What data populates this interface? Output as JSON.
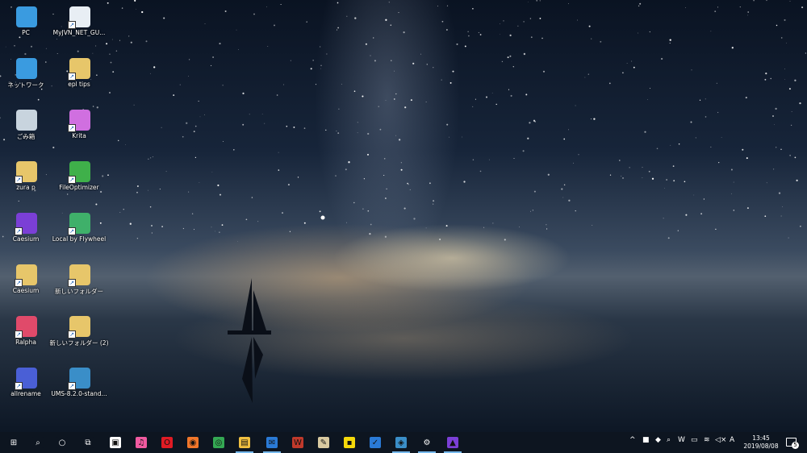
{
  "desktop": {
    "icons": [
      {
        "label": "PC",
        "icon": "this-pc-icon",
        "color": "#3a9be0"
      },
      {
        "label": "MyJVN_NET_GU...",
        "icon": "app-window-icon",
        "color": "#e8eef4"
      },
      {
        "label": "ネットワーク",
        "icon": "network-icon",
        "color": "#3a9be0"
      },
      {
        "label": "epl tips",
        "icon": "folder-icon",
        "color": "#e7c66a"
      },
      {
        "label": "ごみ箱",
        "icon": "recycle-bin-icon",
        "color": "#c8d4de"
      },
      {
        "label": "Krita",
        "icon": "krita-icon",
        "color": "#d06fe0"
      },
      {
        "label": "zura p",
        "icon": "user-folder-icon",
        "color": "#e7c66a"
      },
      {
        "label": "FileOptimizer",
        "icon": "fileoptimizer-icon",
        "color": "#3fb04a"
      },
      {
        "label": "Caesium",
        "icon": "caesium-icon",
        "color": "#7b3fd6"
      },
      {
        "label": "Local by Flywheel",
        "icon": "flywheel-icon",
        "color": "#3fb06a"
      },
      {
        "label": "Caesium",
        "icon": "folder-icon",
        "color": "#e7c66a"
      },
      {
        "label": "新しいフォルダー",
        "icon": "folder-icon",
        "color": "#e7c66a"
      },
      {
        "label": "Ralpha",
        "icon": "ralpha-icon",
        "color": "#e04a6a"
      },
      {
        "label": "新しいフォルダー (2)",
        "icon": "folder-icon",
        "color": "#e7c66a"
      },
      {
        "label": "allrename",
        "icon": "allrename-icon",
        "color": "#4a5fd6"
      },
      {
        "label": "UMS-8.2.0-stand...",
        "icon": "ums-icon",
        "color": "#3a8ec8"
      }
    ]
  },
  "taskbar": {
    "apps": [
      {
        "name": "start-button",
        "glyph": "⊞",
        "color": "#0d1520"
      },
      {
        "name": "search-icon",
        "glyph": "⌕",
        "color": "#0d1520"
      },
      {
        "name": "cortana-icon",
        "glyph": "○",
        "color": "#0d1520"
      },
      {
        "name": "task-view-icon",
        "glyph": "⧉",
        "color": "#0d1520"
      },
      {
        "name": "store-icon",
        "glyph": "▣",
        "color": "#ffffff"
      },
      {
        "name": "itunes-icon",
        "glyph": "♫",
        "color": "#f05aa0"
      },
      {
        "name": "opera-icon",
        "glyph": "O",
        "color": "#e01b24"
      },
      {
        "name": "firefox-icon",
        "glyph": "◉",
        "color": "#f0762a"
      },
      {
        "name": "chrome-icon",
        "glyph": "◎",
        "color": "#34a853"
      },
      {
        "name": "file-explorer-icon",
        "glyph": "▤",
        "color": "#f0c040"
      },
      {
        "name": "outlook-icon",
        "glyph": "✉",
        "color": "#2a7ad6"
      },
      {
        "name": "winamp-icon",
        "glyph": "W",
        "color": "#c0392b"
      },
      {
        "name": "notepad-icon",
        "glyph": "✎",
        "color": "#d8c9a0"
      },
      {
        "name": "sticky-notes-icon",
        "glyph": "▪",
        "color": "#f5d90a"
      },
      {
        "name": "todo-icon",
        "glyph": "✓",
        "color": "#2a7ad6"
      },
      {
        "name": "ums-icon",
        "glyph": "◈",
        "color": "#3a8ec8"
      },
      {
        "name": "settings-icon",
        "glyph": "⚙",
        "color": "#0d1520"
      },
      {
        "name": "caesium-icon",
        "glyph": "▲",
        "color": "#7b3fd6"
      }
    ],
    "tray": [
      {
        "name": "tray-overflow-icon",
        "glyph": "^"
      },
      {
        "name": "nvidia-icon",
        "glyph": "■"
      },
      {
        "name": "security-shield-icon",
        "glyph": "◆"
      },
      {
        "name": "search-tool-icon",
        "glyph": "⌕"
      },
      {
        "name": "winamp-tray-icon",
        "glyph": "W"
      },
      {
        "name": "battery-icon",
        "glyph": "▭"
      },
      {
        "name": "wifi-icon",
        "glyph": "≋"
      },
      {
        "name": "volume-icon",
        "glyph": "◁×"
      },
      {
        "name": "ime-indicator",
        "glyph": "A"
      }
    ],
    "clock": {
      "time": "13:45",
      "date": "2019/08/08"
    },
    "notifications": {
      "count": "5"
    }
  },
  "colors": {
    "taskbar": "#0d1520",
    "active_indicator": "#76b9ed"
  }
}
